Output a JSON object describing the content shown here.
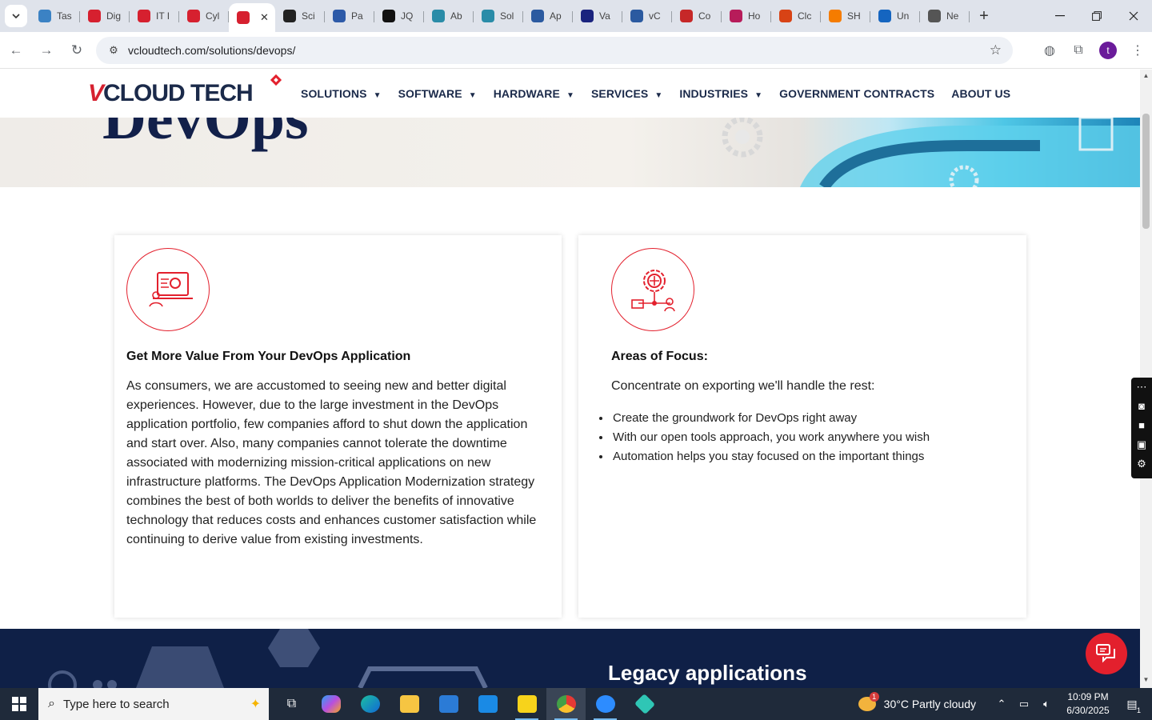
{
  "browser": {
    "tabs": [
      {
        "label": "Tas",
        "color": "#3b82c4"
      },
      {
        "label": "Dig",
        "color": "#d6202f"
      },
      {
        "label": "IT I",
        "color": "#d6202f"
      },
      {
        "label": "Cyl",
        "color": "#d6202f"
      },
      {
        "label": "",
        "color": "#d6202f",
        "active": true
      },
      {
        "label": "Sci",
        "color": "#222222"
      },
      {
        "label": "Pa",
        "color": "#2d5aa8"
      },
      {
        "label": "JQ",
        "color": "#111111"
      },
      {
        "label": "Ab",
        "color": "#2a8ca8"
      },
      {
        "label": "Sol",
        "color": "#2a8ca8"
      },
      {
        "label": "Ap",
        "color": "#2b5aa0"
      },
      {
        "label": "Va",
        "color": "#1a237e"
      },
      {
        "label": "vC",
        "color": "#2b5aa0"
      },
      {
        "label": "Co",
        "color": "#c62828"
      },
      {
        "label": "Ho",
        "color": "#b71c5a"
      },
      {
        "label": "Clc",
        "color": "#d84315"
      },
      {
        "label": "SH",
        "color": "#f57c00"
      },
      {
        "label": "Un",
        "color": "#1565c0"
      },
      {
        "label": "Ne",
        "color": "#555555"
      }
    ],
    "active_tab_close": "✕",
    "new_tab": "+",
    "url": "vcloudtech.com/solutions/devops/",
    "profile_initial": "t"
  },
  "site": {
    "logo_v": "V",
    "logo_rest": "CLOUD TECH",
    "nav": [
      {
        "label": "SOLUTIONS",
        "caret": true
      },
      {
        "label": "SOFTWARE",
        "caret": true
      },
      {
        "label": "HARDWARE",
        "caret": true
      },
      {
        "label": "SERVICES",
        "caret": true
      },
      {
        "label": "INDUSTRIES",
        "caret": true
      },
      {
        "label": "GOVERNMENT CONTRACTS",
        "caret": false
      },
      {
        "label": "ABOUT US",
        "caret": false
      }
    ],
    "hero_title": "DevOps",
    "card_left": {
      "title": "Get More Value From Your DevOps Application",
      "text": "As consumers, we are accustomed to seeing new and better digital experiences. However, due to the large investment in the DevOps application portfolio, few companies afford to shut down the application and start over. Also, many companies cannot tolerate the downtime associated with modernizing mission-critical applications on new infrastructure platforms. The DevOps Application Modernization strategy combines the best of both worlds to deliver the benefits of innovative technology that reduces costs and enhances customer satisfaction while continuing to derive value from existing investments."
    },
    "card_right": {
      "title": "Areas of Focus:",
      "intro": "Concentrate on exporting we'll handle the rest:",
      "bullets": [
        "Create the groundwork for DevOps right away",
        "With our open tools approach, you work anywhere you wish",
        "Automation helps you stay focused on the important things"
      ]
    },
    "dark_section_title": "Legacy applications",
    "accent": "#e3202d",
    "navy": "#1b2a4a"
  },
  "taskbar": {
    "search_placeholder": "Type here to search",
    "weather_badge": "1",
    "weather": "30°C  Partly cloudy",
    "time": "10:09 PM",
    "date": "6/30/2025",
    "notif_count": "1"
  }
}
